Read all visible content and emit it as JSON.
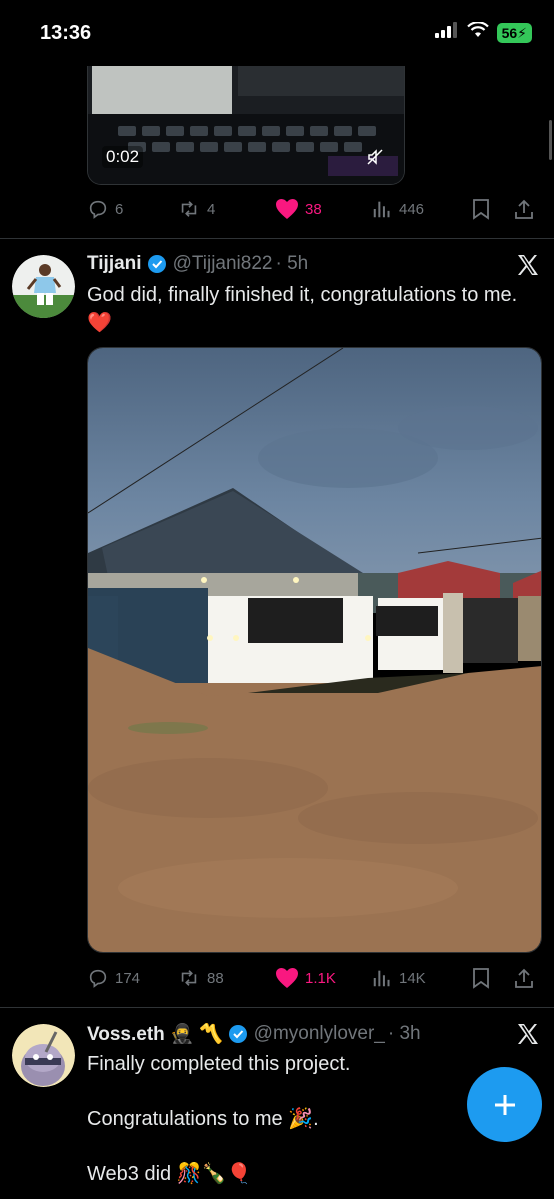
{
  "status_bar": {
    "time": "13:36",
    "battery": "56"
  },
  "colors": {
    "background": "#000000",
    "accent": "#1d9bf0",
    "like": "#f91880",
    "muted": "#71767b",
    "verified": "#1d9bf0"
  },
  "tweet_prev": {
    "video_duration": "0:02",
    "actions": {
      "replies": "6",
      "retweets": "4",
      "likes": "38",
      "views": "446"
    }
  },
  "tweet_1": {
    "display_name": "Tijjani",
    "handle": "@Tijjani822",
    "time": "· 5h",
    "text": "God did, finally finished it, congratulations to me. ❤️",
    "actions": {
      "replies": "174",
      "retweets": "88",
      "likes": "1.1K",
      "views": "14K"
    }
  },
  "tweet_2": {
    "display_name": "Voss.eth 🥷 〽️",
    "handle": "@myonlylover_",
    "time": "· 3h",
    "text_line1": "Finally completed this project.",
    "text_line2": "Congratulations to me 🎉.",
    "text_line3": "Web3 did 🎊🍾🎈"
  },
  "icons": [
    "reply-icon",
    "retweet-icon",
    "like-icon",
    "views-icon",
    "bookmark-icon",
    "share-icon",
    "verified-icon",
    "x-logo-icon",
    "compose-icon",
    "mute-icon",
    "wifi-icon",
    "signal-icon"
  ]
}
